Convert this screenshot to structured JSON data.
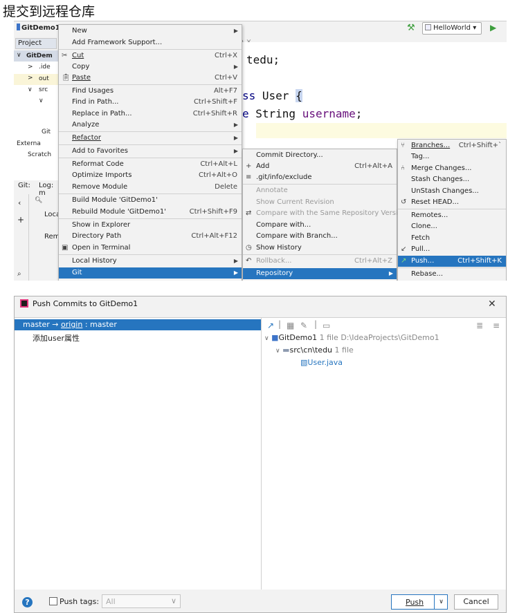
{
  "page_title": "提交到远程仓库",
  "ide": {
    "project_name": "GitDemo1",
    "run_config": "HelloWorld",
    "project_tab": "Project",
    "tree_items": [
      "GitDem",
      ".ide",
      "out",
      "src",
      "Git",
      "Externa",
      "Scratch"
    ],
    "bottom_tabs": [
      "Git:",
      "Log: m"
    ],
    "bottom_items": [
      "Loca",
      "Rem"
    ],
    "editor_tab": "a ×",
    "code_lines": [
      "tedu;",
      "ss User {",
      "e String username;"
    ],
    "code_frag": {
      "kw1": "ss ",
      "cls": "User ",
      "brace": "{",
      "kw2": "e ",
      "type": "String ",
      "field": "username",
      "semi": ";"
    }
  },
  "context_menu": {
    "items": [
      {
        "label": "New",
        "shortcut": "",
        "arrow": true
      },
      {
        "label": "Add Framework Support...",
        "shortcut": ""
      },
      {
        "label": "Cut",
        "shortcut": "Ctrl+X",
        "icon": "cut-icon"
      },
      {
        "label": "Copy",
        "shortcut": "",
        "arrow": true
      },
      {
        "label": "Paste",
        "shortcut": "Ctrl+V",
        "icon": "paste-icon"
      },
      {
        "label": "Find Usages",
        "shortcut": "Alt+F7"
      },
      {
        "label": "Find in Path...",
        "shortcut": "Ctrl+Shift+F"
      },
      {
        "label": "Replace in Path...",
        "shortcut": "Ctrl+Shift+R"
      },
      {
        "label": "Analyze",
        "shortcut": "",
        "arrow": true
      },
      {
        "label": "Refactor",
        "shortcut": "",
        "arrow": true
      },
      {
        "label": "Add to Favorites",
        "shortcut": "",
        "arrow": true
      },
      {
        "label": "Reformat Code",
        "shortcut": "Ctrl+Alt+L"
      },
      {
        "label": "Optimize Imports",
        "shortcut": "Ctrl+Alt+O"
      },
      {
        "label": "Remove Module",
        "shortcut": "Delete"
      },
      {
        "label": "Build Module 'GitDemo1'",
        "shortcut": ""
      },
      {
        "label": "Rebuild Module 'GitDemo1'",
        "shortcut": "Ctrl+Shift+F9"
      },
      {
        "label": "Show in Explorer",
        "shortcut": ""
      },
      {
        "label": "Directory Path",
        "shortcut": "Ctrl+Alt+F12"
      },
      {
        "label": "Open in Terminal",
        "shortcut": "",
        "icon": "terminal-icon"
      },
      {
        "label": "Local History",
        "shortcut": "",
        "arrow": true
      },
      {
        "label": "Git",
        "shortcut": "",
        "arrow": true
      }
    ]
  },
  "git_menu": {
    "items": [
      {
        "label": "Commit Directory...",
        "shortcut": ""
      },
      {
        "label": "Add",
        "shortcut": "Ctrl+Alt+A",
        "icon": "plus-icon"
      },
      {
        "label": ".git/info/exclude",
        "shortcut": "",
        "icon": "file-icon"
      },
      {
        "label": "Annotate",
        "shortcut": ""
      },
      {
        "label": "Show Current Revision",
        "shortcut": ""
      },
      {
        "label": "Compare with the Same Repository Version",
        "shortcut": "",
        "icon": "compare-icon"
      },
      {
        "label": "Compare with...",
        "shortcut": ""
      },
      {
        "label": "Compare with Branch...",
        "shortcut": ""
      },
      {
        "label": "Show History",
        "shortcut": "",
        "icon": "history-icon"
      },
      {
        "label": "Rollback...",
        "shortcut": "Ctrl+Alt+Z",
        "icon": "rollback-icon"
      },
      {
        "label": "Repository",
        "shortcut": "",
        "arrow": true
      }
    ]
  },
  "repo_menu": {
    "items": [
      {
        "label": "Branches...",
        "shortcut": "Ctrl+Shift+`",
        "icon": "branch-icon"
      },
      {
        "label": "Tag...",
        "shortcut": ""
      },
      {
        "label": "Merge Changes...",
        "shortcut": "",
        "icon": "merge-icon"
      },
      {
        "label": "Stash Changes...",
        "shortcut": ""
      },
      {
        "label": "UnStash Changes...",
        "shortcut": ""
      },
      {
        "label": "Reset HEAD...",
        "shortcut": "",
        "icon": "reset-icon"
      },
      {
        "label": "Remotes...",
        "shortcut": ""
      },
      {
        "label": "Clone...",
        "shortcut": ""
      },
      {
        "label": "Fetch",
        "shortcut": ""
      },
      {
        "label": "Pull...",
        "shortcut": "",
        "icon": "pull-icon"
      },
      {
        "label": "Push...",
        "shortcut": "Ctrl+Shift+K",
        "icon": "push-icon"
      },
      {
        "label": "Rebase...",
        "shortcut": ""
      }
    ]
  },
  "dialog": {
    "title": "Push Commits to GitDemo1",
    "branch_local": "master",
    "branch_arrow": "→",
    "branch_remote": "origin",
    "branch_sep": " : ",
    "branch_target": "master",
    "commit_message": "添加user属性",
    "tree": {
      "root_name": "GitDemo1",
      "root_meta": "1 file  D:\\IdeaProjects\\GitDemo1",
      "dir_name": "src\\cn\\tedu",
      "dir_meta": "1 file",
      "file_name": "User.java"
    },
    "footer": {
      "push_tags_label": "Push tags:",
      "tags_value": "All",
      "push_button": "Push",
      "cancel_button": "Cancel",
      "help_label": "?"
    }
  }
}
